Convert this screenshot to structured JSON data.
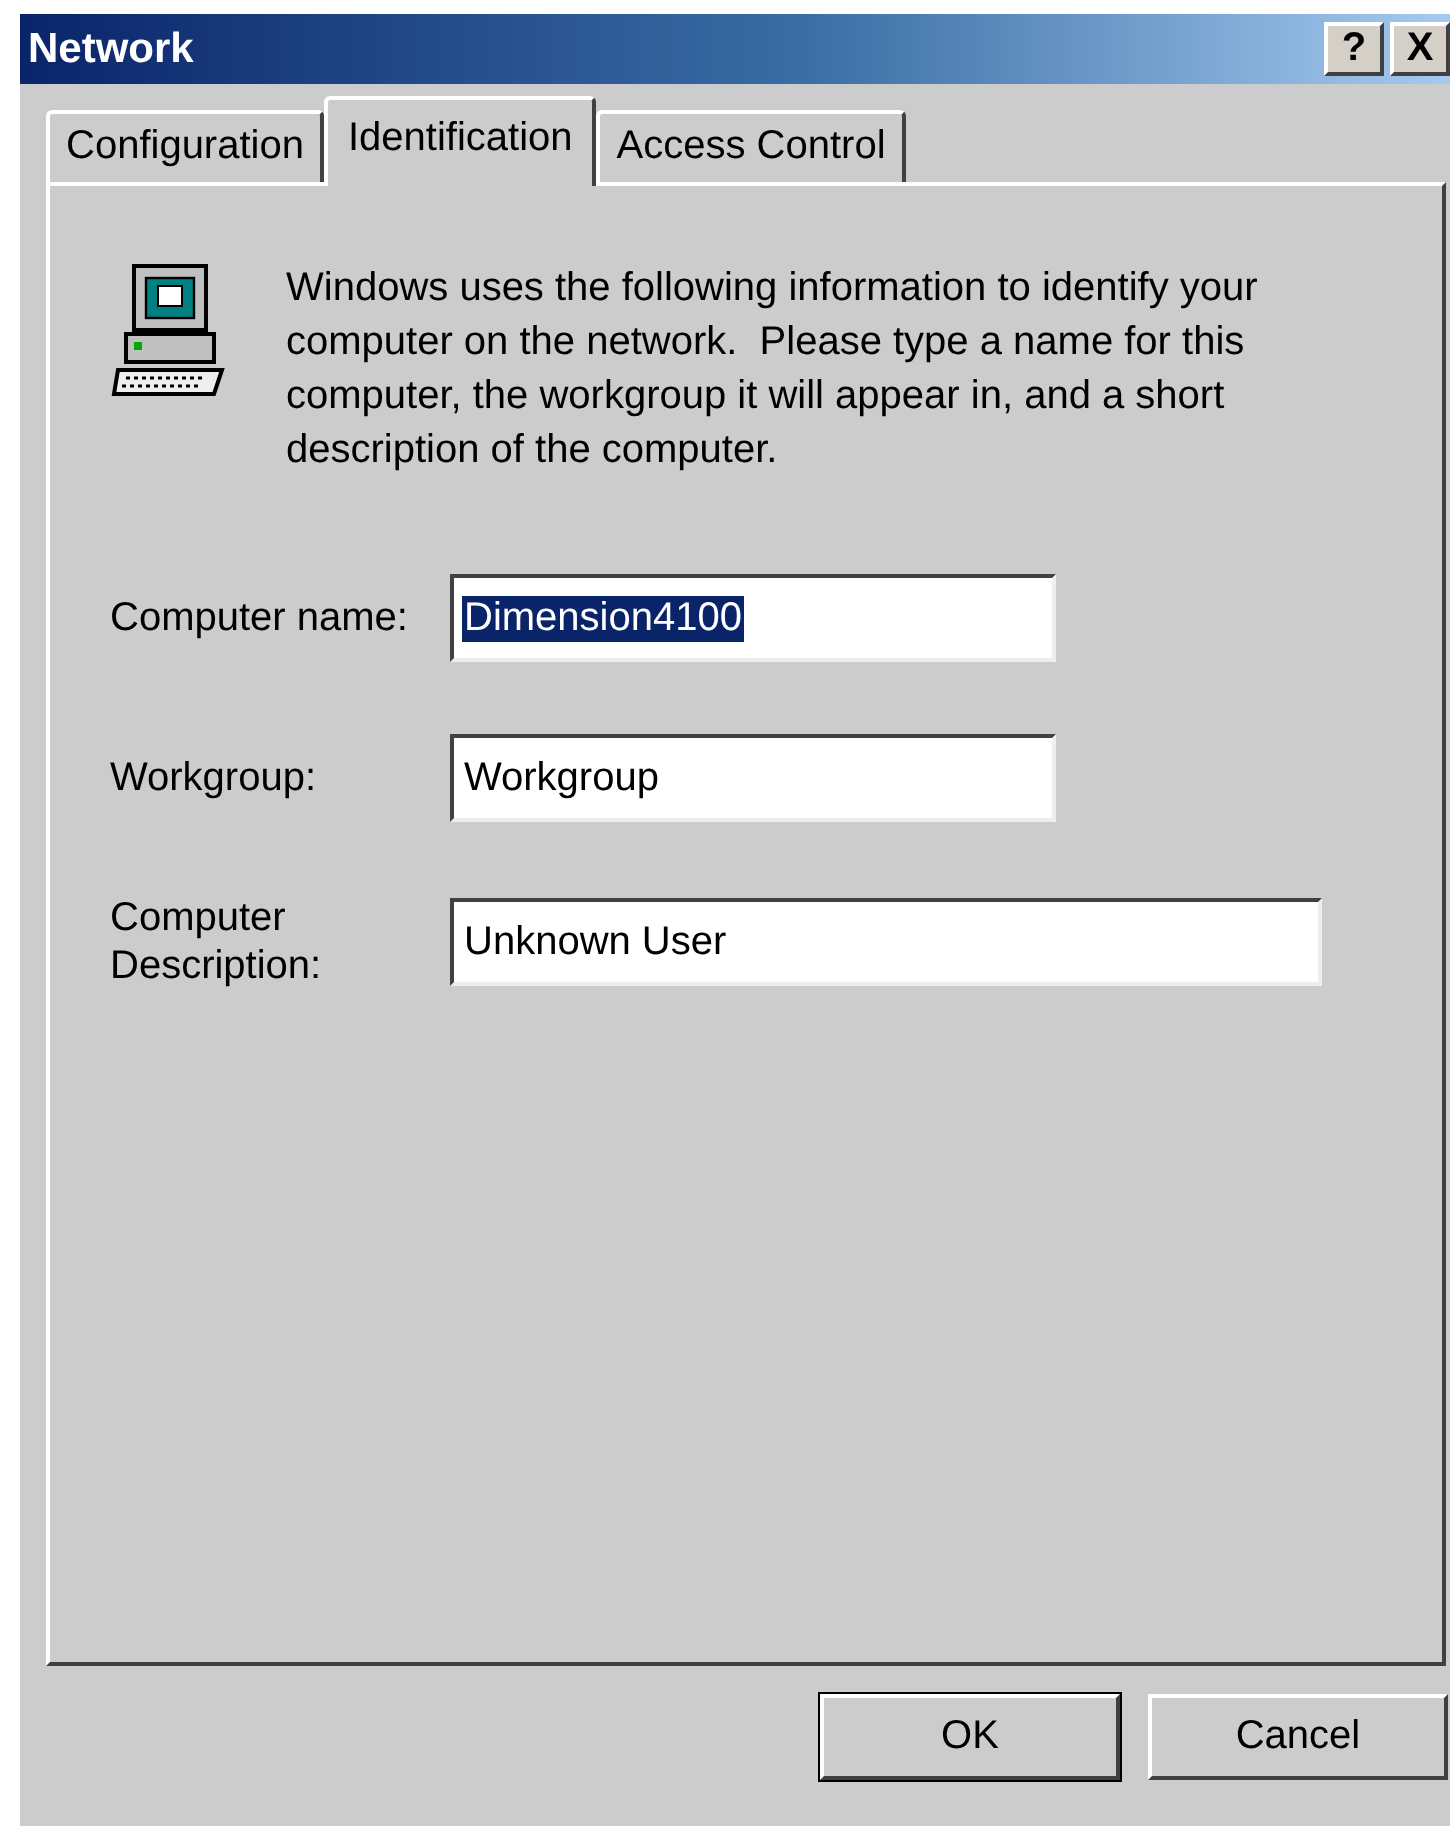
{
  "window": {
    "title": "Network",
    "title_buttons": [
      "?",
      "X"
    ]
  },
  "tabs": [
    {
      "label": "Configuration",
      "selected": false
    },
    {
      "label": "Identification",
      "selected": true
    },
    {
      "label": "Access Control",
      "selected": false
    }
  ],
  "description": "Windows uses the following information to identify your computer on the network.  Please type a name for this computer, the workgroup it will appear in, and a short description of the computer.",
  "fields": [
    {
      "label": "Computer name:",
      "value": "Dimension4100",
      "text_selected": true,
      "wide": false
    },
    {
      "label": "Workgroup:",
      "value": "Workgroup",
      "text_selected": false,
      "wide": false
    },
    {
      "label": "Computer\nDescription:",
      "value": "Unknown User",
      "text_selected": false,
      "wide": true
    }
  ],
  "buttons": [
    {
      "label": "OK",
      "default": true
    },
    {
      "label": "Cancel",
      "default": false
    }
  ]
}
